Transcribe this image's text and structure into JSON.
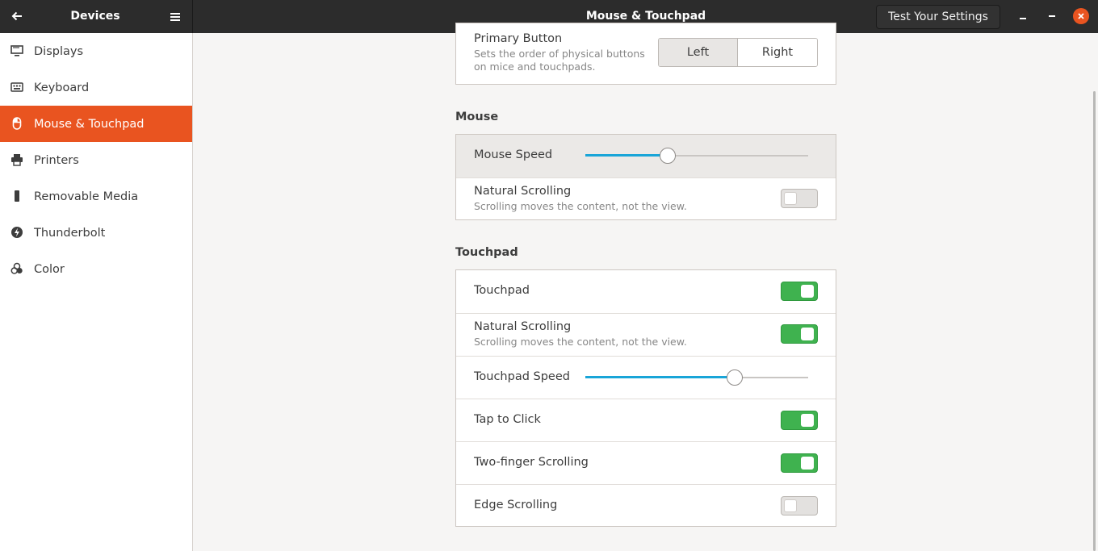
{
  "header": {
    "panel_title": "Devices",
    "window_title": "Mouse & Touchpad",
    "test_button": "Test Your Settings",
    "icons": {
      "back": "back-arrow-icon",
      "menu": "hamburger-menu-icon",
      "minimize": "minimize-icon",
      "maximize": "maximize-icon",
      "close": "close-icon"
    }
  },
  "sidebar": {
    "items": [
      {
        "label": "Displays",
        "icon": "display-icon",
        "active": false
      },
      {
        "label": "Keyboard",
        "icon": "keyboard-icon",
        "active": false
      },
      {
        "label": "Mouse & Touchpad",
        "icon": "mouse-icon",
        "active": true
      },
      {
        "label": "Printers",
        "icon": "printer-icon",
        "active": false
      },
      {
        "label": "Removable Media",
        "icon": "usb-drive-icon",
        "active": false
      },
      {
        "label": "Thunderbolt",
        "icon": "thunderbolt-icon",
        "active": false
      },
      {
        "label": "Color",
        "icon": "color-icon",
        "active": false
      }
    ]
  },
  "general": {
    "primary_button": {
      "title": "Primary Button",
      "subtitle_line1": "Sets the order of physical buttons",
      "subtitle_line2": "on mice and touchpads.",
      "options": [
        "Left",
        "Right"
      ],
      "selected": "Left"
    }
  },
  "mouse": {
    "section_title": "Mouse",
    "speed": {
      "label": "Mouse Speed",
      "value": 0.37
    },
    "natural_scrolling": {
      "label": "Natural Scrolling",
      "subtitle": "Scrolling moves the content, not the view.",
      "on": false
    }
  },
  "touchpad": {
    "section_title": "Touchpad",
    "enabled": {
      "label": "Touchpad",
      "on": true
    },
    "natural_scrolling": {
      "label": "Natural Scrolling",
      "subtitle": "Scrolling moves the content, not the view.",
      "on": true
    },
    "speed": {
      "label": "Touchpad Speed",
      "value": 0.67
    },
    "tap_to_click": {
      "label": "Tap to Click",
      "on": true
    },
    "two_finger_scrolling": {
      "label": "Two-finger Scrolling",
      "on": true
    },
    "edge_scrolling": {
      "label": "Edge Scrolling",
      "on": false
    }
  },
  "colors": {
    "accent": "#e95420",
    "toggle_on": "#3fb24f",
    "slider_fill": "#19a5d8"
  }
}
